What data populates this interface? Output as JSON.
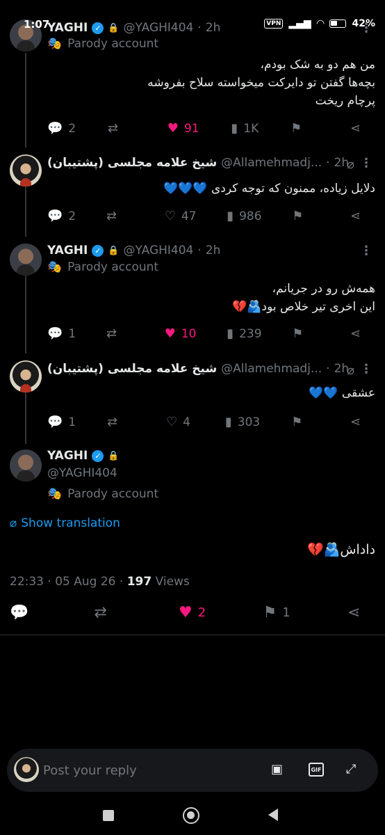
{
  "status_bar": {
    "time": "1:07",
    "vpn": "VPN",
    "battery": "42%"
  },
  "tweets": [
    {
      "display_name": "YAGHI",
      "handle": "@YAGHI404",
      "time": "2h",
      "badge": "Parody account",
      "lines": [
        "من هم دو به شک بودم،",
        "بچه‌ها گفتن تو دایرکت میخواسته سلاح بفروشه",
        "پرچام ریخت"
      ],
      "replies": "2",
      "likes": "91",
      "views": "1K"
    },
    {
      "display_name": "شیخ علامه مجلسی (پشتیبان)",
      "handle": "@Allamehmadj...",
      "time": "2h",
      "lines": [
        "دلایل زیاده، ممنون که توجه کردی 💙💙💙"
      ],
      "replies": "2",
      "likes": "47",
      "views": "986"
    },
    {
      "display_name": "YAGHI",
      "handle": "@YAGHI404",
      "time": "2h",
      "badge": "Parody account",
      "lines": [
        "همه‌ش رو در جریانم،",
        "این اخری تیر خلاص بود🫂💔"
      ],
      "replies": "1",
      "likes": "10",
      "views": "239"
    },
    {
      "display_name": "شیخ علامه مجلسی (پشتیبان)",
      "handle": "@Allamehmadj...",
      "time": "2h",
      "lines": [
        "عشقی 💙💙"
      ],
      "replies": "1",
      "likes": "4",
      "views": "303"
    }
  ],
  "main_tweet": {
    "display_name": "YAGHI",
    "handle": "@YAGHI404",
    "badge": "Parody account",
    "translate_label": "Show translation",
    "text": "داداش🫂💔",
    "time": "22:33",
    "date": "05 Aug 26",
    "views_count": "197",
    "views_label": "Views",
    "likes": "2",
    "bookmarks": "1"
  },
  "reply_bar": {
    "placeholder": "Post your reply",
    "gif_label": "GIF"
  },
  "colors": {
    "background": "#000000",
    "accent": "#1d9bf0",
    "like": "#f91880",
    "muted": "#71767b"
  }
}
